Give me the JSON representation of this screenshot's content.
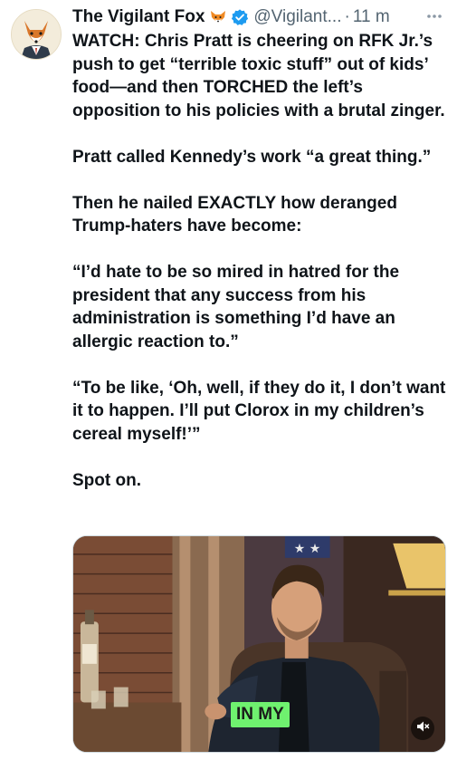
{
  "author": {
    "display_name": "The Vigilant Fox",
    "emoji_icon": "fox-face-icon",
    "verified_icon": "verified-badge-icon",
    "handle": "@Vigilant...",
    "separator": "·",
    "timestamp": "11 m",
    "avatar_icon": "fox-avatar"
  },
  "tweet": {
    "paragraphs": [
      "WATCH: Chris Pratt is cheering on RFK Jr.’s push to get “terrible toxic stuff” out of kids’ food—and then TORCHED the left’s opposition to his policies with a brutal zinger.",
      "Pratt called Kennedy’s work “a great thing.”",
      "Then he nailed EXACTLY how deranged Trump-haters have become:",
      "“I’d hate to be so mired in hatred for the president that any success from his administration is something I’d have an allergic reaction to.”",
      "“To be like, ‘Oh, well, if they do it, I don’t want it to happen. I’ll put Clorox in my children’s cereal myself!’”",
      "Spot on."
    ]
  },
  "media": {
    "caption": "IN MY",
    "mute_icon": "speaker-muted-icon"
  },
  "colors": {
    "text": "#0f1419",
    "secondary": "#536471",
    "verified": "#1d9bf0",
    "caption_bg": "#6ff16f"
  }
}
